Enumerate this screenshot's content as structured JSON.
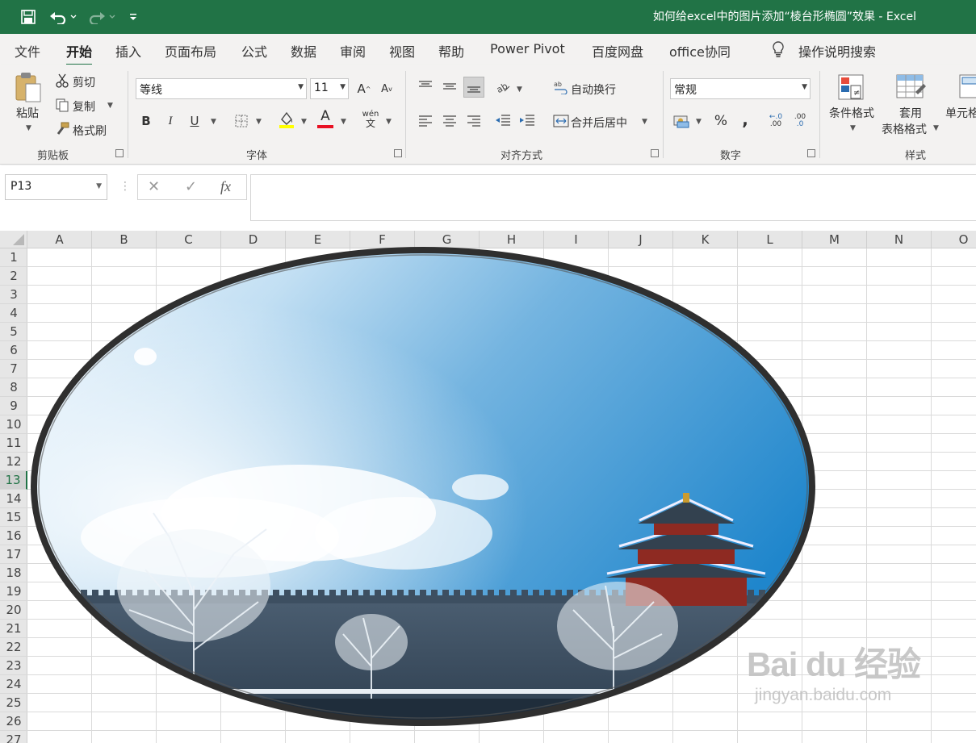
{
  "window": {
    "title": "如何给excel中的图片添加“棱台形椭圆”效果  -  Excel",
    "accent_color": "#217346",
    "quick_access": [
      "save-icon",
      "undo-icon",
      "redo-icon",
      "customize-icon"
    ]
  },
  "tabs": [
    {
      "label": "文件",
      "active": false
    },
    {
      "label": "开始",
      "active": true
    },
    {
      "label": "插入",
      "active": false
    },
    {
      "label": "页面布局",
      "active": false
    },
    {
      "label": "公式",
      "active": false
    },
    {
      "label": "数据",
      "active": false
    },
    {
      "label": "审阅",
      "active": false
    },
    {
      "label": "视图",
      "active": false
    },
    {
      "label": "帮助",
      "active": false
    },
    {
      "label": "Power Pivot",
      "active": false
    },
    {
      "label": "百度网盘",
      "active": false
    },
    {
      "label": "office协同",
      "active": false
    }
  ],
  "tell_me": "操作说明搜索",
  "ribbon": {
    "clipboard": {
      "group": "剪贴板",
      "paste": "粘贴",
      "cut": "剪切",
      "copy": "复制",
      "format_painter": "格式刷"
    },
    "font": {
      "group": "字体",
      "font_name": "等线",
      "font_size": "11",
      "bold": "B",
      "italic": "I",
      "underline": "U",
      "font_color_letter": "A",
      "highlight_color": "#ffff00",
      "font_color": "#e81123",
      "phonetic": "wén"
    },
    "alignment": {
      "group": "对齐方式",
      "wrap_text": "自动换行",
      "merge_center": "合并后居中"
    },
    "number": {
      "group": "数字",
      "format": "常规",
      "percent": "%",
      "comma": ",",
      "inc_decimal": ".00",
      "dec_decimal": ".0"
    },
    "styles": {
      "group": "样式",
      "conditional": "条件格式",
      "table_format_1": "套用",
      "table_format_2": "表格格式",
      "cell_styles": "单元格"
    }
  },
  "formula_bar": {
    "name_box": "P13",
    "fx": "fx",
    "content": ""
  },
  "grid": {
    "columns": [
      "A",
      "B",
      "C",
      "D",
      "E",
      "F",
      "G",
      "H",
      "I",
      "J",
      "K",
      "L",
      "M",
      "N",
      "O"
    ],
    "rows": [
      "1",
      "2",
      "3",
      "4",
      "5",
      "6",
      "7",
      "8",
      "9",
      "10",
      "11",
      "12",
      "13",
      "14",
      "15",
      "16",
      "17",
      "18",
      "19",
      "20",
      "21",
      "22",
      "23",
      "24",
      "25",
      "26",
      "27"
    ],
    "selected_row": "13"
  },
  "image": {
    "description_icon": "forbidden-city-photo",
    "shape": "bevel-ellipse"
  },
  "watermark": {
    "logo": "Bai du 经验",
    "url": "jingyan.baidu.com"
  }
}
